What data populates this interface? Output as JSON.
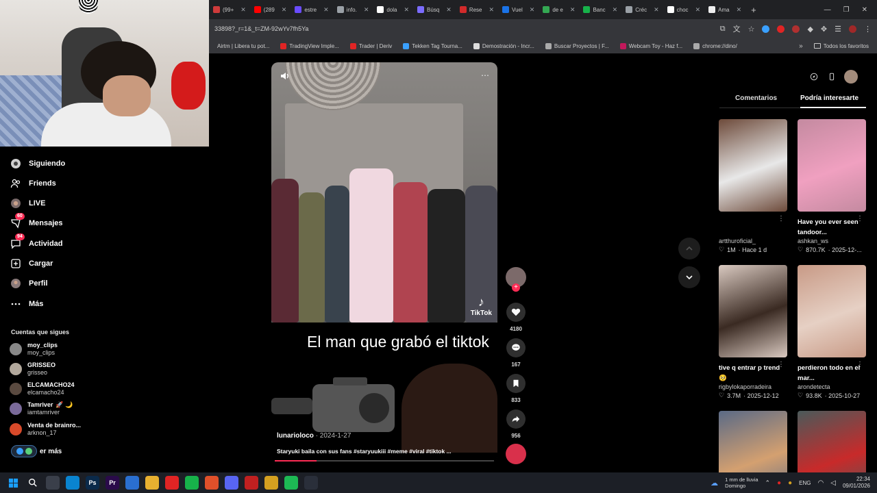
{
  "browser": {
    "tabs": [
      {
        "label": "(99+",
        "color": "#cf3b3b"
      },
      {
        "label": "(289",
        "color": "#ff0000"
      },
      {
        "label": "estre",
        "color": "#6a4cff"
      },
      {
        "label": "info.",
        "color": "#9aa0a6"
      },
      {
        "label": "dola",
        "color": "#ffffff"
      },
      {
        "label": "Búsq",
        "color": "#7b6cff"
      },
      {
        "label": "Rese",
        "color": "#d12a2a"
      },
      {
        "label": "Vuel",
        "color": "#1a73e8"
      },
      {
        "label": "de e",
        "color": "#34a853"
      },
      {
        "label": "Banc",
        "color": "#17b24a"
      },
      {
        "label": "Créc",
        "color": "#9aa0a6"
      },
      {
        "label": "choc",
        "color": "#ffffff"
      },
      {
        "label": "Ama",
        "color": "#eeeeee"
      }
    ],
    "new_tab": "+",
    "url": "33898?_r=1&_t=ZM-92wYv7fh5Ya",
    "bookmarks": [
      {
        "label": "Airtm | Libera tu pot...",
        "color": ""
      },
      {
        "label": "TradingView Imple...",
        "color": "#e02424"
      },
      {
        "label": "Trader | Deriv",
        "color": "#e02424"
      },
      {
        "label": "Tekken Tag Tourna...",
        "color": "#3aa0ff"
      },
      {
        "label": "Demostración - Incr...",
        "color": "#dddddd"
      },
      {
        "label": "Buscar Proyectos | F...",
        "color": "#aaaaaa"
      },
      {
        "label": "Webcam Toy - Haz f...",
        "color": "#c2185b"
      },
      {
        "label": "chrome://dino/",
        "color": "#aaaaaa"
      }
    ],
    "bookmarks_more": "»",
    "all_favorites": "Todos los favoritos"
  },
  "nav": {
    "items": [
      {
        "label": "Siguiendo",
        "icon": "following-icon"
      },
      {
        "label": "Friends",
        "icon": "friends-icon"
      },
      {
        "label": "LIVE",
        "icon": "live-icon"
      },
      {
        "label": "Mensajes",
        "icon": "messages-icon",
        "badge": "60"
      },
      {
        "label": "Actividad",
        "icon": "activity-icon",
        "badge": "94"
      },
      {
        "label": "Cargar",
        "icon": "upload-icon"
      },
      {
        "label": "Perfil",
        "icon": "profile-icon"
      },
      {
        "label": "Más",
        "icon": "more-icon"
      }
    ],
    "following_title": "Cuentas que sigues",
    "accounts": [
      {
        "name": "moy_clips",
        "handle": "moy_clips",
        "color": "#888888",
        "badge": ""
      },
      {
        "name": "GRISSEO",
        "handle": "grisseo",
        "color": "#b2a89c",
        "badge": ""
      },
      {
        "name": "ELCAMACHO24",
        "handle": "elcamacho24",
        "color": "#5a4a40",
        "badge": ""
      },
      {
        "name": "Tamriver",
        "handle": "iamtamriver",
        "color": "#7a6a9a",
        "badge": "🚀 🌙"
      },
      {
        "name": "Venta de brainro...",
        "handle": "arknon_17",
        "color": "#d84a2a",
        "badge": ""
      }
    ],
    "see_more": "er más"
  },
  "video": {
    "caption_big": "El man que grabó el tiktok",
    "watermark": "TikTok",
    "author": "lunarioloco",
    "date": "· 2024-1-27",
    "description": "Staryuki baila con sus fans #staryuukiii #meme #viral #tiktok ...",
    "progress": 0.19,
    "likes": "4180",
    "comments": "167",
    "saves": "833",
    "shares": "956"
  },
  "panel": {
    "tabs": [
      "Comentarios",
      "Podría interesarte"
    ],
    "active_tab": 1,
    "cards": [
      {
        "title": "",
        "author": "artthuroficial_",
        "likes": "1M",
        "time": "· Hace 1 d",
        "bg": "#6d4a3a",
        "accent": "#e8e8e8"
      },
      {
        "title": "Have you ever seen tandoor...",
        "author": "ashkan_ws",
        "likes": "870.7K",
        "time": "· 2025-12-...",
        "bg": "#c48aa0",
        "accent": "#f0a0c0"
      },
      {
        "title": "tive q entrar p trend 🥺",
        "author": "rigbylokaporradeira",
        "likes": "3.7M",
        "time": "· 2025-12-12",
        "bg": "#d9c9c0",
        "accent": "#3a2a22"
      },
      {
        "title": "perdieron todo en el mar...",
        "author": "arondetecta",
        "likes": "93.8K",
        "time": "· 2025-10-27",
        "bg": "#c89a86",
        "accent": "#e6d0c4"
      },
      {
        "title": "",
        "author": "",
        "likes": "",
        "time": "",
        "bg": "#5a6a86",
        "accent": "#d4a070"
      },
      {
        "title": "",
        "author": "",
        "likes": "",
        "time": "",
        "bg": "#4a5a5a",
        "accent": "#c82a2a"
      }
    ]
  },
  "taskbar": {
    "apps": [
      {
        "label": "",
        "color": "#1a9fff",
        "icon": "windows-icon"
      },
      {
        "label": "",
        "color": "transparent",
        "icon": "search-icon"
      },
      {
        "label": "",
        "color": "#3a3f4a",
        "icon": "app-icon"
      },
      {
        "label": "",
        "color": "#0a84d0",
        "icon": "edge-icon"
      },
      {
        "label": "Ps",
        "color": "#0b2a4a",
        "icon": "photoshop-icon"
      },
      {
        "label": "Pr",
        "color": "#2a0b4a",
        "icon": "premiere-icon"
      },
      {
        "label": "",
        "color": "#2a6fd0",
        "icon": "store-icon"
      },
      {
        "label": "",
        "color": "#e8b030",
        "icon": "folder-icon"
      },
      {
        "label": "",
        "color": "#e02424",
        "icon": "deriv-icon"
      },
      {
        "label": "",
        "color": "#17b24a",
        "icon": "xbox-icon"
      },
      {
        "label": "",
        "color": "#e0502a",
        "icon": "brave-icon"
      },
      {
        "label": "",
        "color": "#5865f2",
        "icon": "discord-icon"
      },
      {
        "label": "",
        "color": "#c02020",
        "icon": "opera-icon"
      },
      {
        "label": "",
        "color": "#d4a020",
        "icon": "chrome-icon"
      },
      {
        "label": "",
        "color": "#1db954",
        "icon": "spotify-icon"
      },
      {
        "label": "",
        "color": "#2a2f3a",
        "icon": "github-icon"
      }
    ],
    "weather_line1": "1 mm de lluvia",
    "weather_line2": "Domingo",
    "lang": "ENG",
    "time": "22:34",
    "date": "09/01/2026"
  }
}
